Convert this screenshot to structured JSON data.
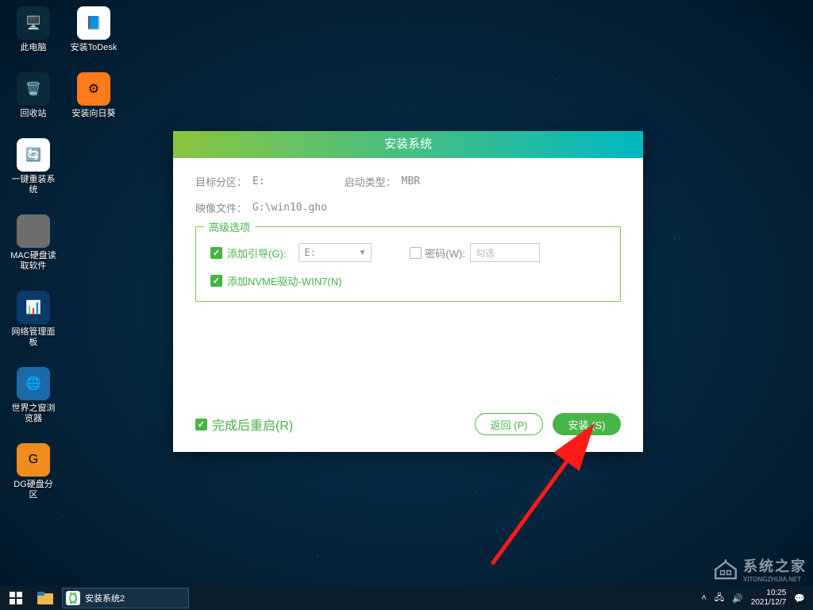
{
  "desktop": {
    "col1": [
      {
        "name": "pc-icon",
        "label": "此电脑",
        "bg": "#0b2a3a",
        "glyph": "🖥️"
      },
      {
        "name": "recycle-icon",
        "label": "回收站",
        "bg": "#0b2a3a",
        "glyph": "🗑️"
      },
      {
        "name": "reinstall-icon",
        "label": "一键重装系统",
        "bg": "#ffffff",
        "glyph": "🔄"
      },
      {
        "name": "mac-disk-icon",
        "label": "MAC硬盘读取软件",
        "bg": "#6e6e6e",
        "glyph": ""
      },
      {
        "name": "netpanel-icon",
        "label": "网络管理面板",
        "bg": "#0b3a6a",
        "glyph": "📊"
      },
      {
        "name": "world-browser-icon",
        "label": "世界之窗浏览器",
        "bg": "#1a6aa8",
        "glyph": "🌐"
      },
      {
        "name": "dg-icon",
        "label": "DG硬盘分区",
        "bg": "#f08b1d",
        "glyph": "G"
      }
    ],
    "col2": [
      {
        "name": "todesk-icon",
        "label": "安装ToDesk",
        "bg": "#ffffff",
        "glyph": "📘"
      },
      {
        "name": "sunflower-icon",
        "label": "安装向日葵",
        "bg": "#ff7b1a",
        "glyph": "⚙"
      }
    ]
  },
  "dialog": {
    "title": "安装系统",
    "target_partition_label": "目标分区：",
    "target_partition_value": "E:",
    "boot_type_label": "启动类型：",
    "boot_type_value": "MBR",
    "image_file_label": "映像文件：",
    "image_file_value": "G:\\win10.gho",
    "advanced_label": "高级选项",
    "add_boot_label": "添加引导(G):",
    "add_boot_drive": "E:",
    "password_label": "密码(W):",
    "password_placeholder": "勾选",
    "add_nvme_label": "添加NVME驱动-WIN7(N)",
    "restart_label": "完成后重启(R)",
    "back_button": "返回 (P)",
    "install_button": "安装 (S)"
  },
  "taskbar": {
    "task_title": "安装系统2",
    "time": "10:25",
    "date": "2021/12/7"
  },
  "watermark": {
    "text": "系统之家",
    "sub": "XITONGZHIJIA.NET"
  }
}
